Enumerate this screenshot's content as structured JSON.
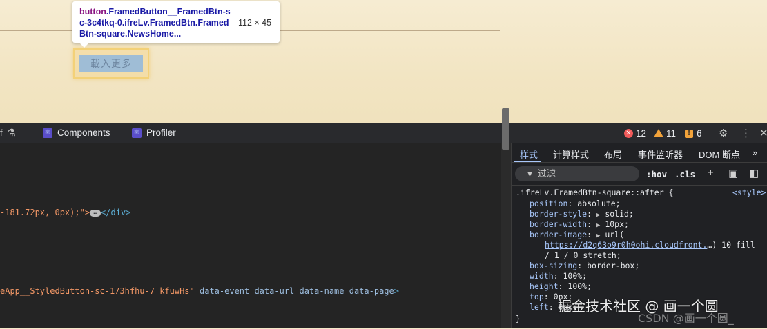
{
  "page": {
    "load_more_label": "載入更多"
  },
  "tooltip": {
    "selector_tag": "button",
    "selector_classes": ".FramedButton__FramedBtn-sc-3c4tkq-0.ifreLv.FramedBtn.FramedBtn-square.NewsHome...",
    "size": "112 × 45"
  },
  "devtools": {
    "tab_left_glyph": "f",
    "tabs": [
      "Components",
      "Profiler"
    ],
    "status": {
      "errors": "12",
      "warnings": "11",
      "issues": "6"
    },
    "elements": {
      "line1_value": "-181.72px, 0px);\">",
      "line1_close_tag": "</div>",
      "line2_value": "eApp__StyledButton-sc-173hfhu-7 kfuwHs\"",
      "line2_attrs": " data-event data-url data-name data-page",
      "line2_end": ">"
    },
    "styles": {
      "tabs": [
        "样式",
        "计算样式",
        "布局",
        "事件监听器",
        "DOM 断点"
      ],
      "more_tabs": "»",
      "filter_placeholder": "过滤",
      "hov": ":hov",
      "cls": ".cls",
      "rule_selector": ".ifreLv.FramedBtn-square::after {",
      "rule_origin": "<style>",
      "declarations": [
        {
          "prop": "position",
          "value": "absolute;"
        },
        {
          "prop": "border-style",
          "value": "solid;"
        },
        {
          "prop": "border-width",
          "value": "10px;"
        },
        {
          "prop": "border-image",
          "value": "url("
        }
      ],
      "border_image_url": "https://d2q63o9r0h0ohi.cloudfront.",
      "border_image_rest": "…) 10 fill",
      "border_image_tail": "/ 1 / 0 stretch;",
      "declarations2": [
        {
          "prop": "box-sizing",
          "value": "border-box;"
        },
        {
          "prop": "width",
          "value": "100%;"
        },
        {
          "prop": "height",
          "value": "100%;"
        },
        {
          "prop": "top",
          "value": "0px;"
        },
        {
          "prop": "left",
          "value": "0px;"
        }
      ],
      "close_brace": "}"
    }
  },
  "watermark": {
    "line1": "掘金技术社区 @ 画一个圆",
    "line2": "CSDN @画一个圆_"
  }
}
